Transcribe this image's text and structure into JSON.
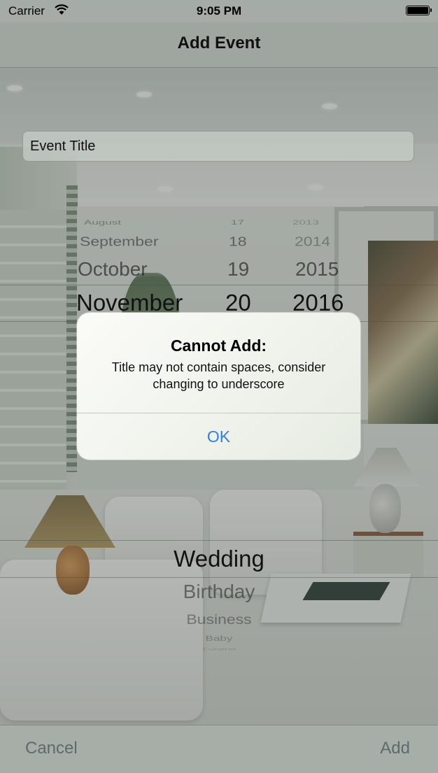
{
  "status_bar": {
    "carrier": "Carrier",
    "time": "9:05 PM"
  },
  "nav": {
    "title": "Add Event"
  },
  "form": {
    "title_field": {
      "value": "Event Title"
    }
  },
  "date_picker": {
    "months": [
      "August",
      "September",
      "October",
      "November"
    ],
    "days": [
      "17",
      "18",
      "19",
      "20"
    ],
    "years": [
      "2013",
      "2014",
      "2015",
      "2016"
    ],
    "selected": {
      "month": "November",
      "day": "20",
      "year": "2016"
    }
  },
  "alert": {
    "title": "Cannot Add:",
    "message": "Title may not contain spaces, consider changing to underscore",
    "ok_label": "OK",
    "ok_color": "#2d7ef0"
  },
  "event_type_picker": {
    "items": [
      "Wedding",
      "Birthday",
      "Business",
      "Baby",
      "Funeral"
    ],
    "selected": "Wedding"
  },
  "toolbar": {
    "cancel_label": "Cancel",
    "add_label": "Add"
  }
}
